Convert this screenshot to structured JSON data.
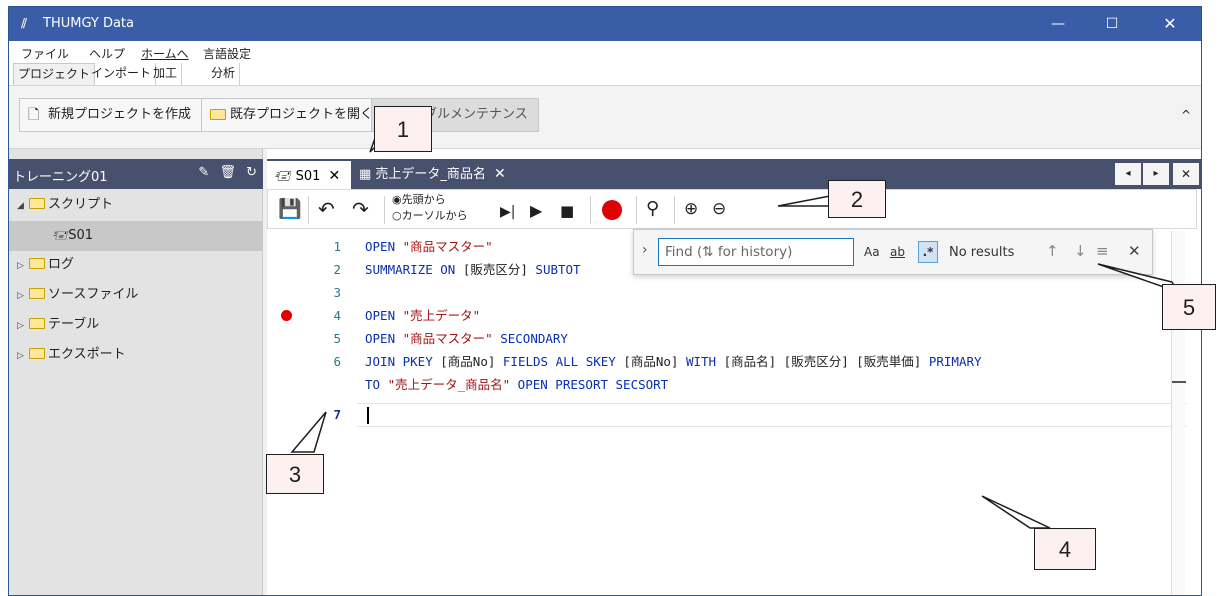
{
  "app": {
    "title": "THUMGY Data",
    "app_icon": "//",
    "min": "—",
    "max": "☐",
    "close": "✕"
  },
  "menu": [
    "ファイル",
    "ヘルプ",
    "ホームへ",
    "言語設定"
  ],
  "ribbon_tabs": [
    "プロジェクト",
    "インポート",
    "加工",
    "分析"
  ],
  "ribbon": {
    "new_project": "新規プロジェクトを作成",
    "open_project": "既存プロジェクトを開く",
    "table_maintenance": "ブルメンテナンス",
    "collapse": "^"
  },
  "left_panel": {
    "project_name": "トレーニング01",
    "tree": [
      {
        "label": "スクリプト",
        "expanded": true
      },
      {
        "label": "S01",
        "child": true,
        "selected": true
      },
      {
        "label": "ログ"
      },
      {
        "label": "ソースファイル"
      },
      {
        "label": "テーブル"
      },
      {
        "label": "エクスポート"
      }
    ]
  },
  "tabs": [
    {
      "label": "S01",
      "close": "✕"
    },
    {
      "label": "売上データ_商品名",
      "close": "✕"
    }
  ],
  "tab_nav": {
    "prev": "◂",
    "next": "▸",
    "close": "✕"
  },
  "toolbar": {
    "radio_from_top": "◉先頭から",
    "radio_from_cursor": "○カーソルから"
  },
  "code_lines": [
    {
      "num": "1",
      "tokens": [
        [
          "kw",
          "OPEN "
        ],
        [
          "st",
          "\"商品マスター\""
        ]
      ]
    },
    {
      "num": "2",
      "tokens": [
        [
          "kw",
          "SUMMARIZE ON "
        ],
        [
          "tx",
          "[販売区分] "
        ],
        [
          "kw",
          "SUBTOT"
        ]
      ]
    },
    {
      "num": "3",
      "tokens": []
    },
    {
      "num": "4",
      "tokens": [
        [
          "kw",
          "OPEN "
        ],
        [
          "st",
          "\"売上データ\""
        ]
      ],
      "breakpoint": true
    },
    {
      "num": "5",
      "tokens": [
        [
          "kw",
          "OPEN "
        ],
        [
          "st",
          "\"商品マスター\""
        ],
        [
          "kw",
          " SECONDARY"
        ]
      ]
    },
    {
      "num": "6",
      "tokens": [
        [
          "kw",
          "JOIN PKEY "
        ],
        [
          "tx",
          "[商品No] "
        ],
        [
          "kw",
          "FIELDS ALL SKEY "
        ],
        [
          "tx",
          "[商品No] "
        ],
        [
          "kw",
          "WITH "
        ],
        [
          "tx",
          "[商品名] [販売区分] [販売単価] "
        ],
        [
          "kw",
          "PRIMARY"
        ]
      ]
    },
    {
      "num": "",
      "tokens": [
        [
          "kw",
          "TO "
        ],
        [
          "st",
          "\"売上データ_商品名\""
        ],
        [
          "kw",
          " OPEN PRESORT SECSORT"
        ]
      ]
    },
    {
      "num": "7",
      "tokens": [],
      "current": true
    }
  ],
  "find": {
    "placeholder": "Find (⇅ for history)",
    "match_case": "Aa",
    "whole_word": "ab",
    "regex": ".*",
    "results": "No results",
    "prev": "↑",
    "next": "↓",
    "in_selection": "≡",
    "close": "✕"
  },
  "callouts": [
    "1",
    "2",
    "3",
    "4",
    "5"
  ]
}
